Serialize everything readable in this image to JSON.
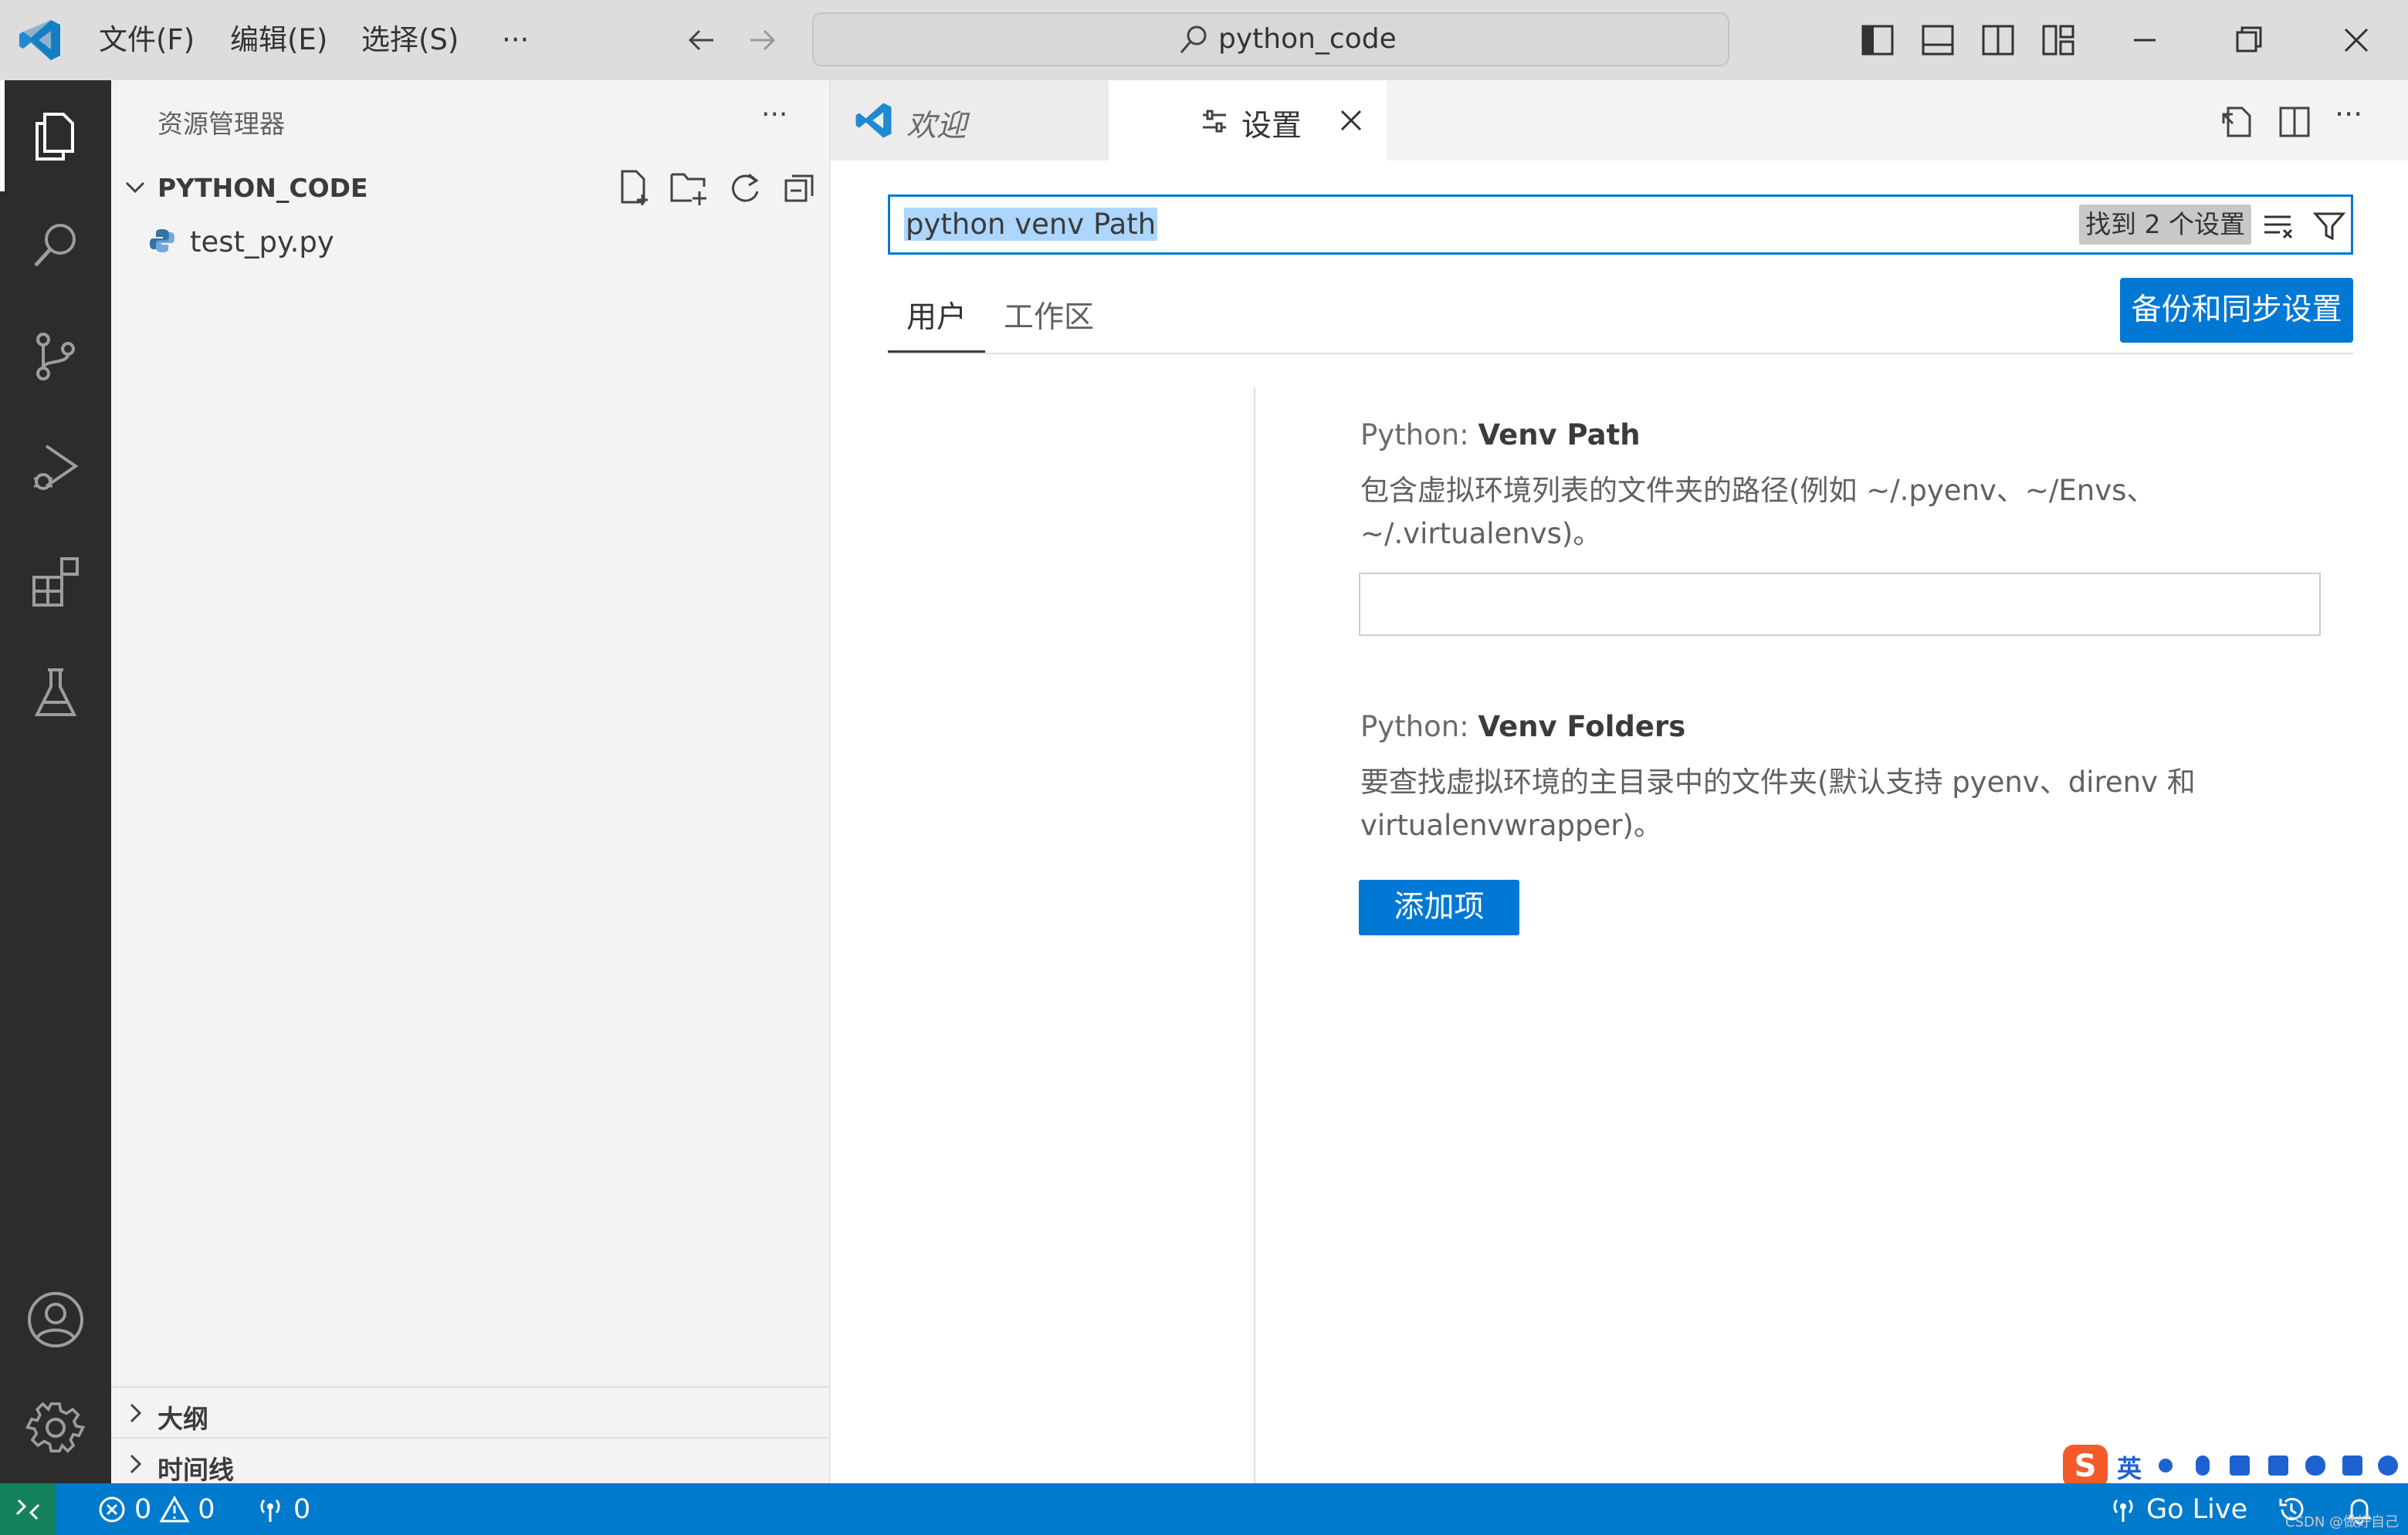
{
  "titlebar": {
    "menu": [
      "文件(F)",
      "编辑(E)",
      "选择(S)",
      "···"
    ],
    "command_center": "python_code"
  },
  "activity": {
    "items": [
      "explorer-icon",
      "search-icon",
      "source-control-icon",
      "run-debug-icon",
      "extensions-icon",
      "testing-icon",
      "account-icon",
      "gear-icon"
    ]
  },
  "sidebar": {
    "title": "资源管理器",
    "more": "···",
    "folder": "PYTHON_CODE",
    "files": [
      "test_py.py"
    ],
    "panels": [
      "大纲",
      "时间线"
    ]
  },
  "tabs": {
    "welcome": "欢迎",
    "settings": "设置",
    "more": "···"
  },
  "settings": {
    "search_value": "python venv Path",
    "found": "找到 2 个设置",
    "scope_tabs": [
      "用户",
      "工作区"
    ],
    "sync_button": "备份和同步设置",
    "items": [
      {
        "category": "Python: ",
        "name": "Venv Path",
        "description": "包含虚拟环境列表的文件夹的路径(例如 ~/.pyenv、~/Envs、~/.virtualenvs)。",
        "value": ""
      },
      {
        "category": "Python: ",
        "name": "Venv Folders",
        "description": "要查找虚拟环境的主目录中的文件夹(默认支持 pyenv、direnv 和 virtualenvwrapper)。",
        "add_button": "添加项"
      }
    ]
  },
  "statusbar": {
    "errors": "0",
    "warnings": "0",
    "ports": "0",
    "go_live": "Go Live"
  },
  "ime": {
    "logo": "S",
    "lang": "英"
  },
  "watermark": "CSDN @做好自己",
  "colors": {
    "accent": "#0078d4",
    "statusbar": "#007acc",
    "activitybar": "#2c2c2c",
    "remote": "#16825d"
  }
}
